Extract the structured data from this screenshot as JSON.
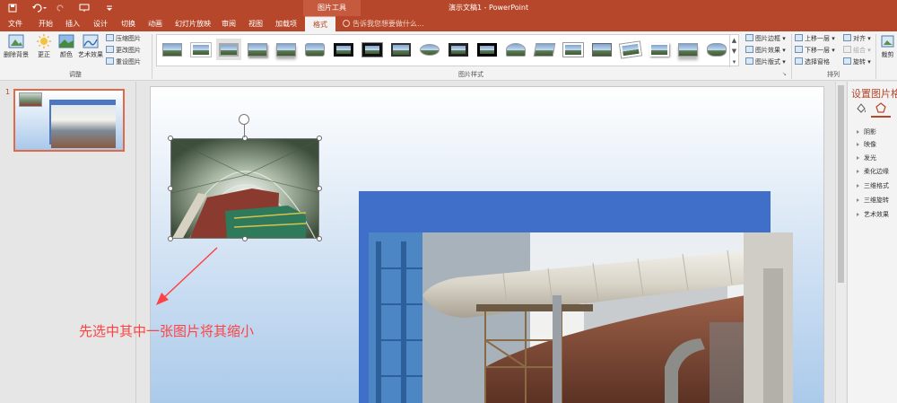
{
  "title_bar": {
    "context_title": "图片工具",
    "window_title": "演示文稿1 - PowerPoint"
  },
  "tabs": [
    "文件",
    "开始",
    "插入",
    "设计",
    "切换",
    "动画",
    "幻灯片放映",
    "审阅",
    "视图",
    "加载项",
    "格式"
  ],
  "active_tab": "格式",
  "tell_me": "告诉我您想要做什么...",
  "ribbon": {
    "adjust": {
      "remove_background": "删除背景",
      "corrections": "更正",
      "color": "颜色",
      "artistic_effects": "艺术效果",
      "compress": "压缩图片",
      "change_picture": "更改图片",
      "reset_picture": "重设图片",
      "label": "调整"
    },
    "picture_styles": {
      "border": "图片边框",
      "effects": "图片效果",
      "layout": "图片版式",
      "label": "图片样式"
    },
    "arrange": {
      "bring_forward": "上移一层",
      "send_backward": "下移一层",
      "selection_pane": "选择窗格",
      "align": "对齐",
      "group": "组合",
      "rotate": "旋转",
      "label": "排列"
    },
    "size": {
      "crop": "裁剪"
    }
  },
  "thumbnail_pane": {
    "slide_number": "1"
  },
  "annotation": "先选中其中一张图片将其缩小",
  "format_pane": {
    "title": "设置图片格式",
    "items": [
      "阴影",
      "映像",
      "发光",
      "柔化边缘",
      "三维格式",
      "三维旋转",
      "艺术效果"
    ]
  },
  "colors": {
    "accent": "#b7472a",
    "annotation": "#ff4242",
    "selection_border": "#e0694a"
  }
}
